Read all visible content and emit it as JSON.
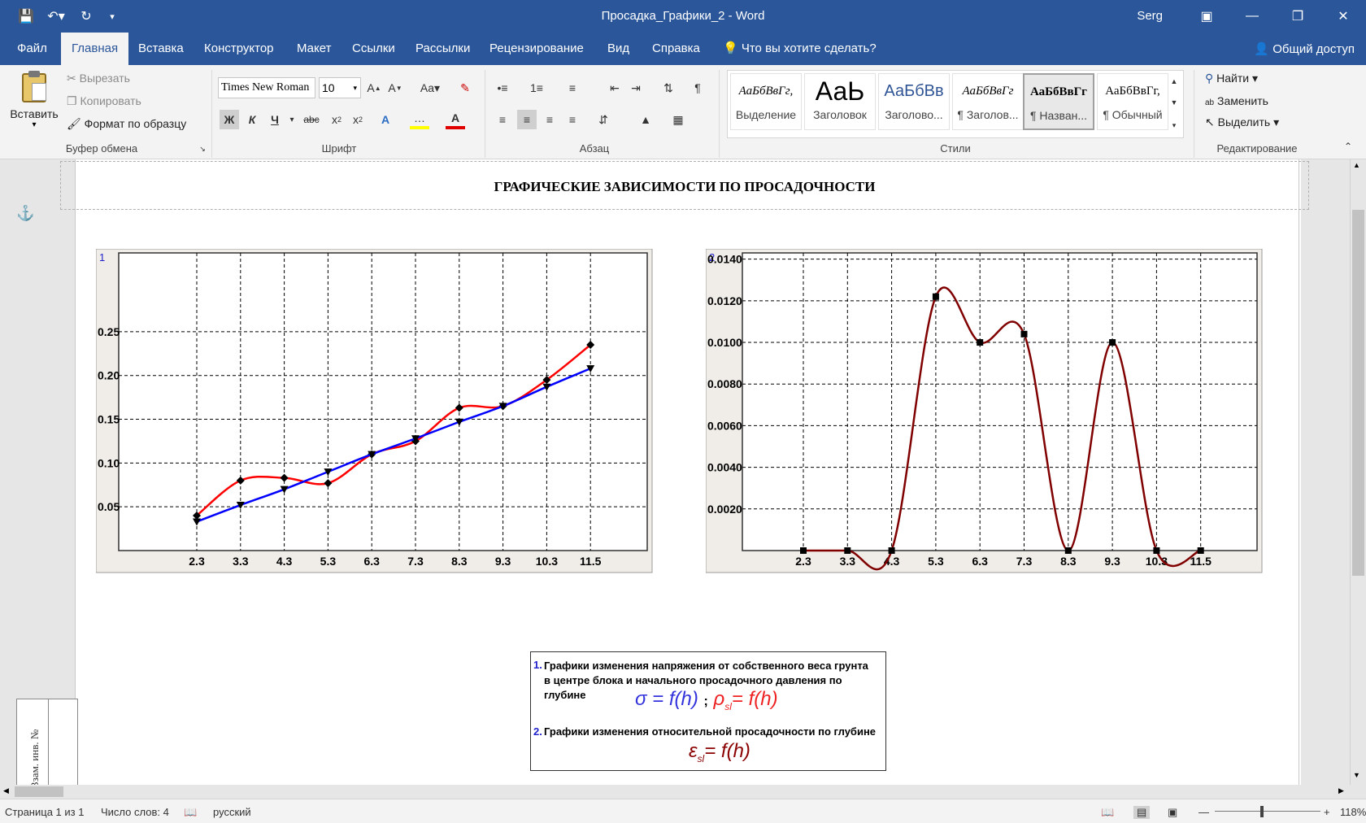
{
  "window": {
    "title": "Просадка_Графики_2  -  Word",
    "user": "Serg"
  },
  "tabs": [
    "Файл",
    "Главная",
    "Вставка",
    "Конструктор",
    "Макет",
    "Ссылки",
    "Рассылки",
    "Рецензирование",
    "Вид",
    "Справка"
  ],
  "tell_me": "Что вы хотите сделать?",
  "share": "Общий доступ",
  "clipboard": {
    "paste": "Вставить",
    "cut": "Вырезать",
    "copy": "Копировать",
    "format_painter": "Формат по образцу",
    "label": "Буфер обмена"
  },
  "font": {
    "name": "Times New Roman",
    "size": "10",
    "label": "Шрифт",
    "bold": "Ж",
    "italic": "К",
    "underline": "Ч",
    "strike": "abc",
    "change_case": "Aa"
  },
  "paragraph": {
    "label": "Абзац"
  },
  "styles": {
    "label": "Стили",
    "items": [
      {
        "sample": "АаБбВвГг,",
        "name": "Выделение"
      },
      {
        "sample": "АаЬ",
        "name": "Заголовок"
      },
      {
        "sample": "АаБбВв",
        "name": "Заголово..."
      },
      {
        "sample": "АаБбВвГг",
        "name": "¶ Заголов..."
      },
      {
        "sample": "АаБбВвГг",
        "name": "¶ Назван..."
      },
      {
        "sample": "АаБбВвГг,",
        "name": "¶ Обычный"
      }
    ]
  },
  "editing": {
    "find": "Найти",
    "replace": "Заменить",
    "select": "Выделить",
    "label": "Редактирование"
  },
  "document": {
    "heading": "ГРАФИЧЕСКИЕ ЗАВИСИМОСТИ ПО ПРОСАДОЧНОСТИ",
    "side_stamp": "Взам. инв. №",
    "legend": {
      "item1_num": "1.",
      "item1_text": "Графики изменения напряжения от собственного веса грунта в центре блока и начального просадочного давления по глубине",
      "item1_formula_a": "σ = f(h)",
      "item1_sep": ";",
      "item1_formula_b": "ρ",
      "item1_formula_b_sub": "sl",
      "item1_formula_b_rest": "= f(h)",
      "item2_num": "2.",
      "item2_text": "Графики изменения относительной просадочности по глубине",
      "item2_formula": "ε",
      "item2_formula_sub": "sl",
      "item2_formula_rest": "= f(h)"
    }
  },
  "chart_data": [
    {
      "type": "line",
      "label": "1",
      "categories": [
        "2.3",
        "3.3",
        "4.3",
        "5.3",
        "6.3",
        "7.3",
        "8.3",
        "9.3",
        "10.3",
        "11.5"
      ],
      "x": [
        2.3,
        3.3,
        4.3,
        5.3,
        6.3,
        7.3,
        8.3,
        9.3,
        10.3,
        11.5
      ],
      "yticks": [
        "0.05",
        "0.10",
        "0.15",
        "0.20",
        "0.25"
      ],
      "ylim": [
        0,
        0.34
      ],
      "grid": true,
      "series": [
        {
          "color": "#ff0000",
          "marker": "diamond",
          "values": [
            0.04,
            0.08,
            0.083,
            0.077,
            0.11,
            0.125,
            0.163,
            0.165,
            0.195,
            0.235
          ]
        },
        {
          "color": "#0000ff",
          "marker": "triangle-down",
          "values": [
            0.033,
            0.052,
            0.07,
            0.09,
            0.11,
            0.128,
            0.147,
            0.165,
            0.187,
            0.208
          ]
        }
      ]
    },
    {
      "type": "line",
      "label": "2",
      "categories": [
        "2.3",
        "3.3",
        "4.3",
        "5.3",
        "6.3",
        "7.3",
        "8.3",
        "9.3",
        "10.3",
        "11.5"
      ],
      "x": [
        2.3,
        3.3,
        4.3,
        5.3,
        6.3,
        7.3,
        8.3,
        9.3,
        10.3,
        11.5
      ],
      "yticks": [
        "0.0020",
        "0.0040",
        "0.0060",
        "0.0080",
        "0.0100",
        "0.0120",
        "0.0140"
      ],
      "ylim": [
        0,
        0.0143
      ],
      "grid": true,
      "series": [
        {
          "color": "#800000",
          "marker": "square",
          "values": [
            0.0,
            0.0,
            0.0,
            0.0122,
            0.01,
            0.0104,
            0.0,
            0.01,
            0.0,
            0.0
          ]
        }
      ]
    }
  ],
  "status": {
    "page": "Страница 1 из 1",
    "words": "Число слов: 4",
    "lang": "русский",
    "zoom": "118%"
  }
}
